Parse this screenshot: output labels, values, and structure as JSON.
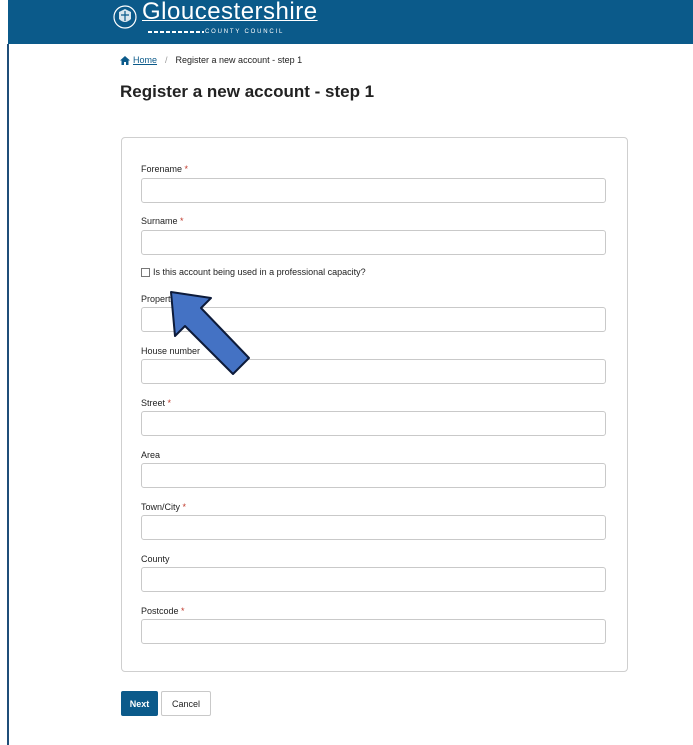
{
  "header": {
    "brand_name": "Gloucestershire",
    "brand_sub": "COUNTY COUNCIL"
  },
  "breadcrumb": {
    "home": "Home",
    "separator": "/",
    "current": "Register a new account - step 1"
  },
  "page": {
    "title": "Register a new account - step 1"
  },
  "form": {
    "forename": {
      "label": "Forename",
      "value": ""
    },
    "surname": {
      "label": "Surname",
      "value": ""
    },
    "professional_checkbox": {
      "label": "Is this account being used in a professional capacity?",
      "checked": false
    },
    "property": {
      "label": "Propert",
      "value": ""
    },
    "house_number": {
      "label": "House number",
      "value": ""
    },
    "street": {
      "label": "Street",
      "value": ""
    },
    "area": {
      "label": "Area",
      "value": ""
    },
    "town_city": {
      "label": "Town/City",
      "value": ""
    },
    "county": {
      "label": "County",
      "value": ""
    },
    "postcode": {
      "label": "Postcode",
      "value": ""
    },
    "required_marker": "*"
  },
  "buttons": {
    "next": "Next",
    "cancel": "Cancel"
  },
  "colors": {
    "header": "#0b5a8a",
    "primary_button": "#0b5a8a",
    "annotation_arrow": "#4472c4",
    "required": "#c0392b"
  }
}
